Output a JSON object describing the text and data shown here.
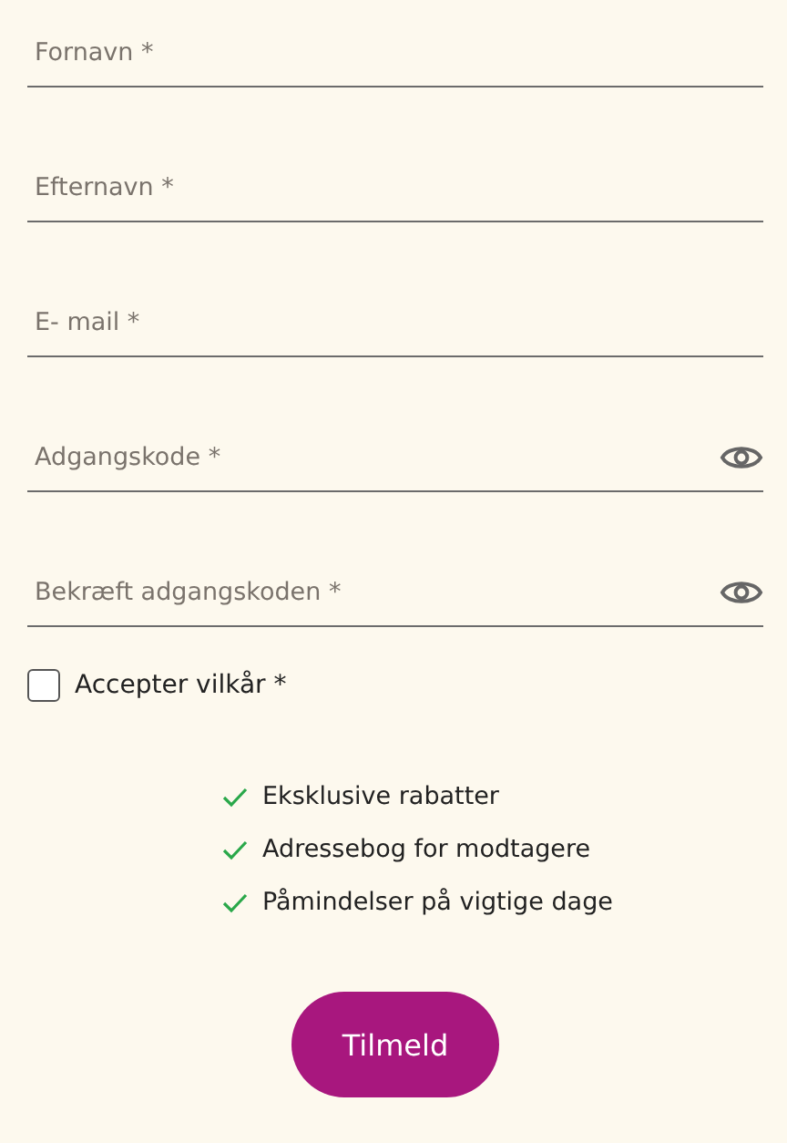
{
  "fields": [
    {
      "placeholder": "Fornavn *",
      "kind": "text"
    },
    {
      "placeholder": "Efternavn *",
      "kind": "text"
    },
    {
      "placeholder": "E- mail *",
      "kind": "text"
    },
    {
      "placeholder": "Adgangskode *",
      "kind": "password"
    },
    {
      "placeholder": "Bekræft adgangskoden *",
      "kind": "password"
    }
  ],
  "terms": {
    "label": "Accepter vilkår *",
    "checked": false
  },
  "benefits": [
    "Eksklusive rabatter",
    "Adressebog for modtagere",
    "Påmindelser på vigtige dage"
  ],
  "submit": "Tilmeld"
}
